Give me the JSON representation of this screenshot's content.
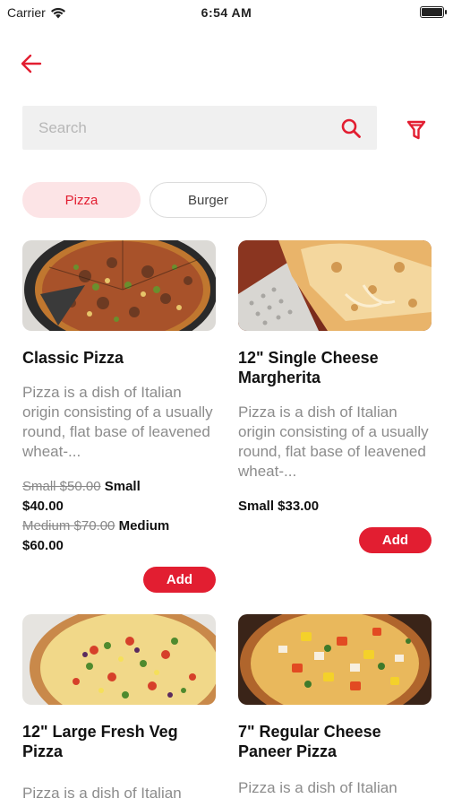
{
  "status_bar": {
    "carrier": "Carrier",
    "time": "6:54 AM"
  },
  "search": {
    "placeholder": "Search"
  },
  "categories": [
    {
      "label": "Pizza",
      "active": true
    },
    {
      "label": "Burger",
      "active": false
    }
  ],
  "add_label": "Add",
  "products": [
    {
      "title": "Classic Pizza",
      "description": "Pizza is a dish of Italian origin consisting of a usually round, flat base of leavened wheat-...",
      "price_lines": [
        {
          "old": "Small $50.00",
          "new": "Small"
        },
        {
          "text": "$40.00"
        },
        {
          "old": "Medium $70.00",
          "new": "Medium"
        },
        {
          "text": "$60.00"
        }
      ]
    },
    {
      "title": "12\" Single Cheese Margherita",
      "description": "Pizza is a dish of Italian origin consisting of a usually round, flat base of leavened wheat-...",
      "price_lines": [
        {
          "text": "Small $33.00"
        }
      ]
    },
    {
      "title": "12\" Large Fresh Veg Pizza",
      "description": "Pizza is a dish of Italian"
    },
    {
      "title": "7\" Regular Cheese Paneer Pizza",
      "description": "Pizza is a dish of Italian"
    }
  ],
  "colors": {
    "accent": "#e21e31",
    "chip_active_bg": "#fce4e6",
    "search_bg": "#f0f0f0"
  }
}
